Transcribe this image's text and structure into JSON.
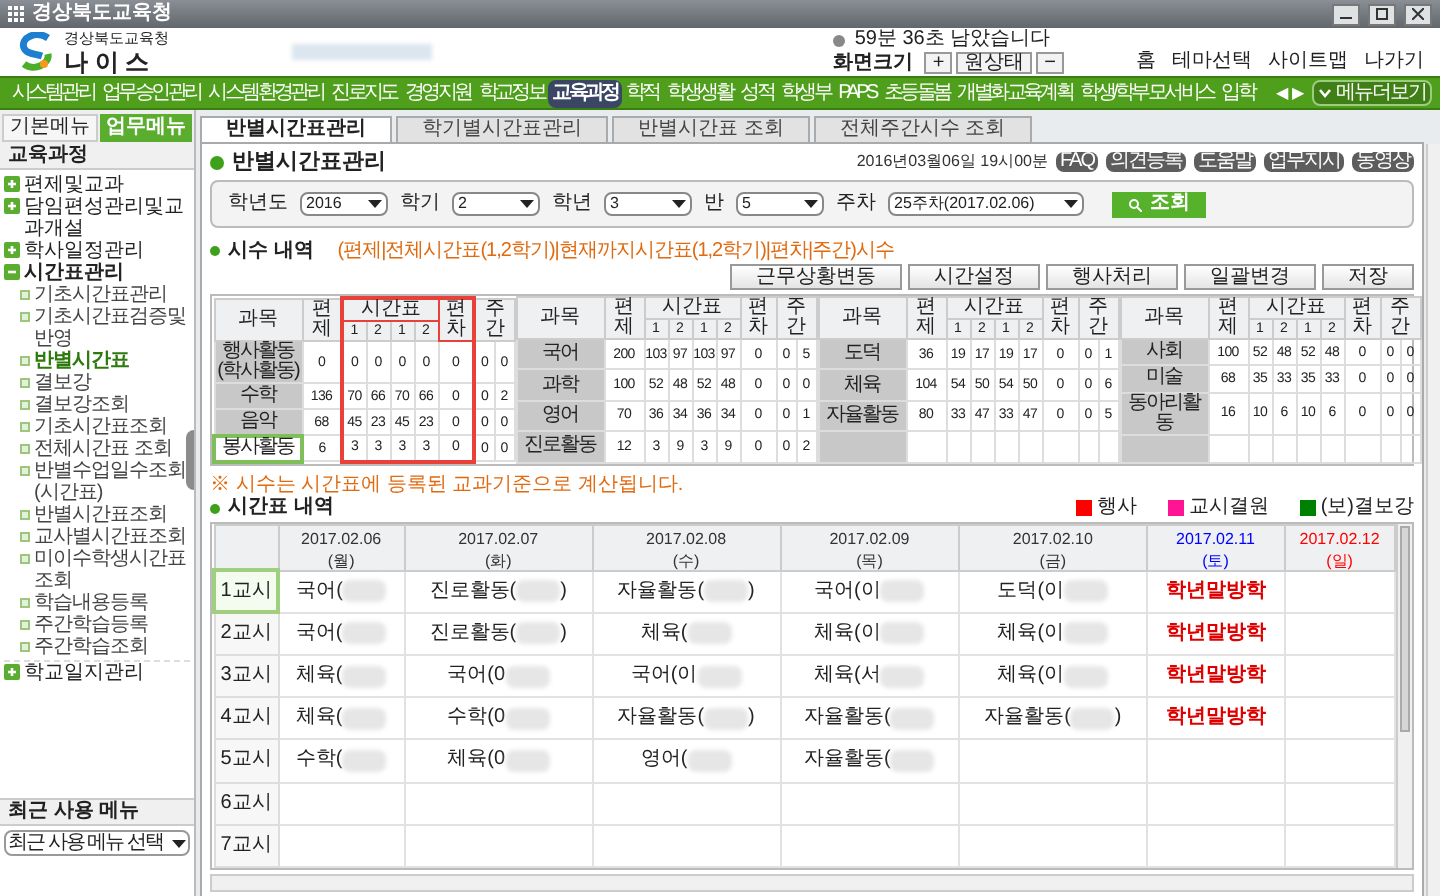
{
  "window": {
    "title": "경상북도교육청"
  },
  "header": {
    "org": "경상북도교육청",
    "brand": "나 이 스",
    "timer": "59분 36초 남았습니다",
    "zoom_label": "화면크기",
    "zoom_buttons": [
      "+",
      "원상태",
      "−"
    ],
    "links": [
      "홈",
      "테마선택",
      "사이트맵",
      "나가기"
    ]
  },
  "nav": {
    "items": [
      {
        "label": "시스템관리",
        "selected": false
      },
      {
        "label": "업무승인관리",
        "selected": false
      },
      {
        "label": "시스템환경관리",
        "selected": false
      },
      {
        "label": "진로지도",
        "selected": false
      },
      {
        "label": "경영지원",
        "selected": false
      },
      {
        "label": "학교정보",
        "selected": false
      },
      {
        "label": "교육과정",
        "selected": true
      },
      {
        "label": "학적",
        "selected": false
      },
      {
        "label": "학생생활",
        "selected": false
      },
      {
        "label": "성적",
        "selected": false
      },
      {
        "label": "학생부",
        "selected": false
      },
      {
        "label": "PAPS",
        "selected": false
      },
      {
        "label": "초등돌봄",
        "selected": false
      },
      {
        "label": "개별화교육계획",
        "selected": false
      },
      {
        "label": "학생/학부모서비스",
        "selected": false
      },
      {
        "label": "입학",
        "selected": false
      }
    ],
    "prev": "◀",
    "next": "▶",
    "more": "메뉴더보기"
  },
  "sidebar": {
    "tabs": [
      {
        "label": "기본메뉴",
        "selected": false
      },
      {
        "label": "업무메뉴",
        "selected": true
      }
    ],
    "title": "교육과정",
    "items": [
      {
        "label": "편제및교과",
        "expanded": false
      },
      {
        "label": "담임편성관리및교과개설",
        "expanded": false
      },
      {
        "label": "학사일정관리",
        "expanded": false
      },
      {
        "label": "시간표관리",
        "expanded": true,
        "children": [
          {
            "label": "기초시간표관리",
            "selected": false
          },
          {
            "label": "기초시간표검증및반영",
            "selected": false
          },
          {
            "label": "반별시간표",
            "selected": true
          },
          {
            "label": "결보강",
            "selected": false
          },
          {
            "label": "결보강조회",
            "selected": false
          },
          {
            "label": "기초시간표조회",
            "selected": false
          },
          {
            "label": "전체시간표 조회",
            "selected": false
          },
          {
            "label": "반별수업일수조회(시간표)",
            "selected": false
          },
          {
            "label": "반별시간표조회",
            "selected": false
          },
          {
            "label": "교사별시간표조회",
            "selected": false
          },
          {
            "label": "미이수학생시간표조회",
            "selected": false
          },
          {
            "label": "학습내용등록",
            "selected": false
          },
          {
            "label": "주간학습등록",
            "selected": false
          },
          {
            "label": "주간학습조회",
            "selected": false
          }
        ]
      },
      {
        "label": "학교일지관리",
        "expanded": false
      }
    ],
    "recent_title": "최근 사용 메뉴",
    "recent_select": "최근 사용 메뉴 선택"
  },
  "tabs": [
    {
      "label": "반별시간표관리",
      "selected": true
    },
    {
      "label": "학기별시간표관리",
      "selected": false
    },
    {
      "label": "반별시간표 조회",
      "selected": false
    },
    {
      "label": "전체주간시수 조회",
      "selected": false
    }
  ],
  "page": {
    "title": "반별시간표관리",
    "datetime": "2016년03월06일 19시00분",
    "tools": [
      "FAQ",
      "의견등록",
      "도움말",
      "업무지시",
      "동영상"
    ]
  },
  "filters": [
    {
      "label": "학년도",
      "value": "2016"
    },
    {
      "label": "학기",
      "value": "2"
    },
    {
      "label": "학년",
      "value": "3"
    },
    {
      "label": "반",
      "value": "5"
    },
    {
      "label": "주차",
      "value": "25주차(2017.02.06)"
    }
  ],
  "search_button": "조회",
  "summary": {
    "title": "시수 내역",
    "note": "(편제|전체시간표(1,2학기)|현재까지시간표(1,2학기)|편차|주간)시수",
    "buttons": [
      "근무상황변동",
      "시간설정",
      "행사처리",
      "일괄변경",
      "저장"
    ],
    "groups": [
      {
        "highlighted": true,
        "header": {
          "subject": "과목",
          "plan": "편제",
          "timetable": "시간표",
          "terms": [
            "1",
            "2",
            "1",
            "2"
          ],
          "diff": "편차",
          "weekly": "주간"
        },
        "rows": [
          {
            "subject": "행사활동(학사활동)",
            "selected": false,
            "values": [
              "0",
              "0",
              "0",
              "0",
              "0",
              "0",
              "0",
              "0"
            ]
          },
          {
            "subject": "수학",
            "selected": false,
            "values": [
              "136",
              "70",
              "66",
              "70",
              "66",
              "0",
              "0",
              "2"
            ]
          },
          {
            "subject": "음악",
            "selected": false,
            "values": [
              "68",
              "45",
              "23",
              "45",
              "23",
              "0",
              "0",
              "0"
            ]
          },
          {
            "subject": "봉사활동",
            "selected": true,
            "values": [
              "6",
              "3",
              "3",
              "3",
              "3",
              "0",
              "0",
              "0"
            ]
          }
        ]
      },
      {
        "highlighted": false,
        "header": {
          "subject": "과목",
          "plan": "편제",
          "timetable": "시간표",
          "terms": [
            "1",
            "2",
            "1",
            "2"
          ],
          "diff": "편차",
          "weekly": "주간"
        },
        "rows": [
          {
            "subject": "국어",
            "selected": false,
            "values": [
              "200",
              "103",
              "97",
              "103",
              "97",
              "0",
              "0",
              "5"
            ]
          },
          {
            "subject": "과학",
            "selected": false,
            "values": [
              "100",
              "52",
              "48",
              "52",
              "48",
              "0",
              "0",
              "0"
            ]
          },
          {
            "subject": "영어",
            "selected": false,
            "values": [
              "70",
              "36",
              "34",
              "36",
              "34",
              "0",
              "0",
              "1"
            ]
          },
          {
            "subject": "진로활동",
            "selected": false,
            "values": [
              "12",
              "3",
              "9",
              "3",
              "9",
              "0",
              "0",
              "2"
            ]
          }
        ]
      },
      {
        "highlighted": false,
        "header": {
          "subject": "과목",
          "plan": "편제",
          "timetable": "시간표",
          "terms": [
            "1",
            "2",
            "1",
            "2"
          ],
          "diff": "편차",
          "weekly": "주간"
        },
        "rows": [
          {
            "subject": "도덕",
            "selected": false,
            "values": [
              "36",
              "19",
              "17",
              "19",
              "17",
              "0",
              "0",
              "1"
            ]
          },
          {
            "subject": "체육",
            "selected": false,
            "values": [
              "104",
              "54",
              "50",
              "54",
              "50",
              "0",
              "0",
              "6"
            ]
          },
          {
            "subject": "자율활동",
            "selected": false,
            "values": [
              "80",
              "33",
              "47",
              "33",
              "47",
              "0",
              "0",
              "5"
            ]
          }
        ]
      },
      {
        "highlighted": false,
        "header": {
          "subject": "과목",
          "plan": "편제",
          "timetable": "시간표",
          "terms": [
            "1",
            "2",
            "1",
            "2"
          ],
          "diff": "편차",
          "weekly": "주간"
        },
        "rows": [
          {
            "subject": "사회",
            "selected": false,
            "values": [
              "100",
              "52",
              "48",
              "52",
              "48",
              "0",
              "0",
              "0"
            ]
          },
          {
            "subject": "미술",
            "selected": false,
            "values": [
              "68",
              "35",
              "33",
              "35",
              "33",
              "0",
              "0",
              "0"
            ]
          },
          {
            "subject": "동아리활동",
            "selected": false,
            "values": [
              "16",
              "10",
              "6",
              "10",
              "6",
              "0",
              "0",
              "0"
            ]
          }
        ]
      }
    ]
  },
  "calc_note": "※ 시수는 시간표에 등록된 교과기준으로 계산됩니다.",
  "legend": [
    {
      "label": "행사",
      "color": "#ff0000"
    },
    {
      "label": "교시결원",
      "color": "#ff1493"
    },
    {
      "label": "(보)결보강",
      "color": "#008000"
    }
  ],
  "timetable": {
    "title": "시간표 내역",
    "columns": [
      {
        "date": "2017.02.06",
        "day": "(월)",
        "kind": "weekday"
      },
      {
        "date": "2017.02.07",
        "day": "(화)",
        "kind": "weekday"
      },
      {
        "date": "2017.02.08",
        "day": "(수)",
        "kind": "weekday"
      },
      {
        "date": "2017.02.09",
        "day": "(목)",
        "kind": "weekday"
      },
      {
        "date": "2017.02.10",
        "day": "(금)",
        "kind": "weekday"
      },
      {
        "date": "2017.02.11",
        "day": "(토)",
        "kind": "saturday"
      },
      {
        "date": "2017.02.12",
        "day": "(일)",
        "kind": "sunday"
      }
    ],
    "rows": [
      {
        "period": "1교시",
        "selected": true,
        "cells": [
          {
            "kind": "class",
            "text": "국어("
          },
          {
            "kind": "class",
            "text": "진로활동(",
            "after": ")"
          },
          {
            "kind": "class",
            "text": "자율활동(",
            "after": ")"
          },
          {
            "kind": "class",
            "text": "국어(이"
          },
          {
            "kind": "class",
            "text": "도덕(이"
          },
          {
            "kind": "event",
            "text": "학년말방학"
          },
          null
        ]
      },
      {
        "period": "2교시",
        "selected": false,
        "cells": [
          {
            "kind": "class",
            "text": "국어("
          },
          {
            "kind": "class",
            "text": "진로활동(",
            "after": ")"
          },
          {
            "kind": "class",
            "text": "체육("
          },
          {
            "kind": "class",
            "text": "체육(이"
          },
          {
            "kind": "class",
            "text": "체육(이"
          },
          {
            "kind": "event",
            "text": "학년말방학"
          },
          null
        ]
      },
      {
        "period": "3교시",
        "selected": false,
        "cells": [
          {
            "kind": "class",
            "text": "체육("
          },
          {
            "kind": "class",
            "text": "국어(0"
          },
          {
            "kind": "class",
            "text": "국어(이"
          },
          {
            "kind": "class",
            "text": "체육(서"
          },
          {
            "kind": "class",
            "text": "체육(이"
          },
          {
            "kind": "event",
            "text": "학년말방학"
          },
          null
        ]
      },
      {
        "period": "4교시",
        "selected": false,
        "cells": [
          {
            "kind": "class",
            "text": "체육("
          },
          {
            "kind": "class",
            "text": "수학(0"
          },
          {
            "kind": "class",
            "text": "자율활동(",
            "after": ")"
          },
          {
            "kind": "class",
            "text": "자율활동("
          },
          {
            "kind": "class",
            "text": "자율활동(",
            "after": ")"
          },
          {
            "kind": "event",
            "text": "학년말방학"
          },
          null
        ]
      },
      {
        "period": "5교시",
        "selected": false,
        "cells": [
          {
            "kind": "class",
            "text": "수학("
          },
          {
            "kind": "class",
            "text": "체육(0"
          },
          {
            "kind": "class",
            "text": "영어("
          },
          {
            "kind": "class",
            "text": "자율활동("
          },
          null,
          null,
          null
        ]
      },
      {
        "period": "6교시",
        "selected": false,
        "cells": [
          null,
          null,
          null,
          null,
          null,
          null,
          null
        ]
      },
      {
        "period": "7교시",
        "selected": false,
        "cells": [
          null,
          null,
          null,
          null,
          null,
          null,
          null
        ]
      }
    ]
  }
}
